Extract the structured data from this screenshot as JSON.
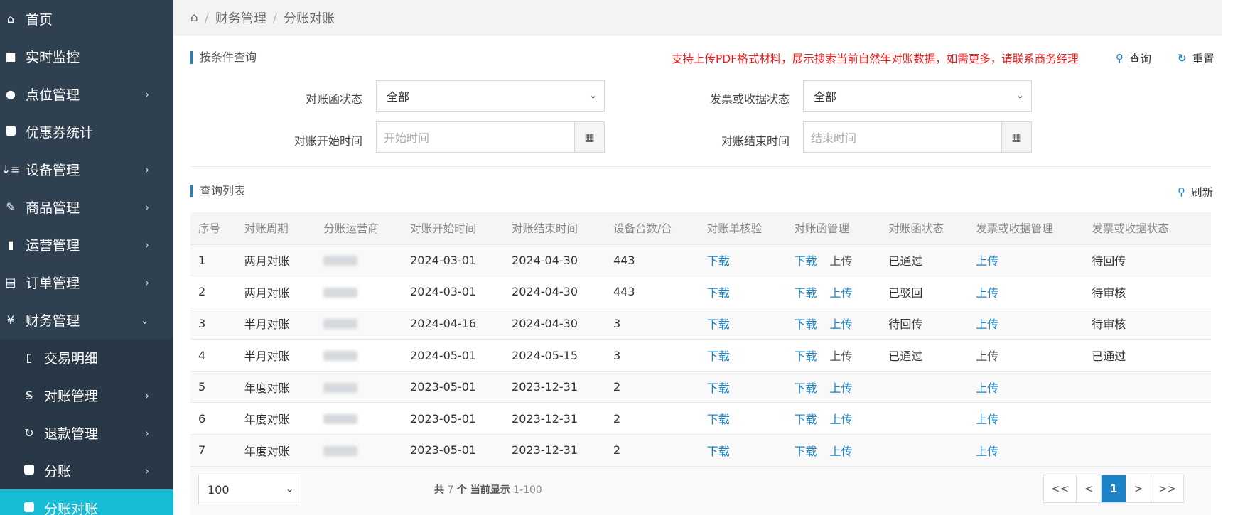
{
  "sidebar": {
    "items": [
      {
        "icon": "home-icon",
        "glyph": "⌂",
        "label": "首页",
        "arrow": ""
      },
      {
        "icon": "video-camera-icon",
        "glyph": "■",
        "label": "实时监控",
        "arrow": ""
      },
      {
        "icon": "map-marker-icon",
        "glyph": "●",
        "label": "点位管理",
        "arrow": "›"
      },
      {
        "icon": "square-icon",
        "glyph": "■",
        "label": "优惠券统计",
        "arrow": ""
      },
      {
        "icon": "sort-icon",
        "glyph": "↓≡",
        "label": "设备管理",
        "arrow": "›"
      },
      {
        "icon": "edit-icon",
        "glyph": "✎",
        "label": "商品管理",
        "arrow": "›"
      },
      {
        "icon": "bookmark-icon",
        "glyph": "▮",
        "label": "运营管理",
        "arrow": "›"
      },
      {
        "icon": "list-alt-icon",
        "glyph": "▤",
        "label": "订单管理",
        "arrow": "›"
      },
      {
        "icon": "yen-icon",
        "glyph": "¥",
        "label": "财务管理",
        "arrow": "⌄"
      }
    ],
    "sub_items": [
      {
        "icon": "file-text-icon",
        "glyph": "▯",
        "label": "交易明细",
        "arrow": ""
      },
      {
        "icon": "strikethrough-icon",
        "glyph": "S̶",
        "label": "对账管理",
        "arrow": "›"
      },
      {
        "icon": "refresh-icon",
        "glyph": "↻",
        "label": "退款管理",
        "arrow": "›"
      },
      {
        "icon": "square-icon",
        "glyph": "■",
        "label": "分账",
        "arrow": "›"
      },
      {
        "icon": "square-icon",
        "glyph": "■",
        "label": "分账对账",
        "arrow": ""
      }
    ]
  },
  "breadcrumb": {
    "home_icon": "home-icon",
    "level1": "财务管理",
    "level2": "分账对账",
    "sep": "/"
  },
  "search": {
    "title": "按条件查询",
    "notice": "支持上传PDF格式材料，展示搜索当前自然年对账数据，如需更多，请联系商务经理",
    "query_label": "查询",
    "reset_label": "重置",
    "letter_status_label": "对账函状态",
    "letter_status_value": "全部",
    "invoice_status_label": "发票或收据状态",
    "invoice_status_value": "全部",
    "start_time_label": "对账开始时间",
    "start_time_placeholder": "开始时间",
    "end_time_label": "对账结束时间",
    "end_time_placeholder": "结束时间"
  },
  "list": {
    "title": "查询列表",
    "refresh_label": "刷新",
    "columns": [
      "序号",
      "对账周期",
      "分账运营商",
      "对账开始时间",
      "对账结束时间",
      "设备台数/台",
      "对账单核验",
      "对账函管理",
      "对账函状态",
      "发票或收据管理",
      "发票或收据状态"
    ],
    "rows": [
      {
        "no": "1",
        "period": "两月对账",
        "start": "2024-03-01",
        "end": "2024-04-30",
        "devices": "443",
        "verify": "下载",
        "letter_dl": "下载",
        "letter_ul": "上传",
        "letter_ul_link": false,
        "letter_status": "已通过",
        "invoice_mgmt": "上传",
        "invoice_link": true,
        "invoice_status": "待回传"
      },
      {
        "no": "2",
        "period": "两月对账",
        "start": "2024-03-01",
        "end": "2024-04-30",
        "devices": "443",
        "verify": "下载",
        "letter_dl": "下载",
        "letter_ul": "上传",
        "letter_ul_link": true,
        "letter_status": "已驳回",
        "invoice_mgmt": "上传",
        "invoice_link": true,
        "invoice_status": "待审核"
      },
      {
        "no": "3",
        "period": "半月对账",
        "start": "2024-04-16",
        "end": "2024-04-30",
        "devices": "3",
        "verify": "下载",
        "letter_dl": "下载",
        "letter_ul": "上传",
        "letter_ul_link": true,
        "letter_status": "待回传",
        "invoice_mgmt": "上传",
        "invoice_link": true,
        "invoice_status": "待审核"
      },
      {
        "no": "4",
        "period": "半月对账",
        "start": "2024-05-01",
        "end": "2024-05-15",
        "devices": "3",
        "verify": "下载",
        "letter_dl": "下载",
        "letter_ul": "上传",
        "letter_ul_link": false,
        "letter_status": "已通过",
        "invoice_mgmt": "上传",
        "invoice_link": false,
        "invoice_status": "已通过"
      },
      {
        "no": "5",
        "period": "年度对账",
        "start": "2023-05-01",
        "end": "2023-12-31",
        "devices": "2",
        "verify": "下载",
        "letter_dl": "下载",
        "letter_ul": "上传",
        "letter_ul_link": true,
        "letter_status": "",
        "invoice_mgmt": "上传",
        "invoice_link": true,
        "invoice_status": ""
      },
      {
        "no": "6",
        "period": "年度对账",
        "start": "2023-05-01",
        "end": "2023-12-31",
        "devices": "2",
        "verify": "下载",
        "letter_dl": "下载",
        "letter_ul": "上传",
        "letter_ul_link": true,
        "letter_status": "",
        "invoice_mgmt": "上传",
        "invoice_link": true,
        "invoice_status": ""
      },
      {
        "no": "7",
        "period": "年度对账",
        "start": "2023-05-01",
        "end": "2023-12-31",
        "devices": "2",
        "verify": "下载",
        "letter_dl": "下载",
        "letter_ul": "上传",
        "letter_ul_link": true,
        "letter_status": "",
        "invoice_mgmt": "上传",
        "invoice_link": true,
        "invoice_status": ""
      }
    ]
  },
  "pagination": {
    "page_size": "100",
    "total_prefix": "共",
    "total": "7",
    "total_mid": "个 当前显示",
    "range": "1-100",
    "first": "<<",
    "prev": "<",
    "current": "1",
    "next": ">",
    "last": ">>"
  },
  "colors": {
    "accent": "#1c84c6",
    "sidebar": "#2f4050",
    "active": "#16bbd5",
    "notice": "#ed1c1c"
  }
}
